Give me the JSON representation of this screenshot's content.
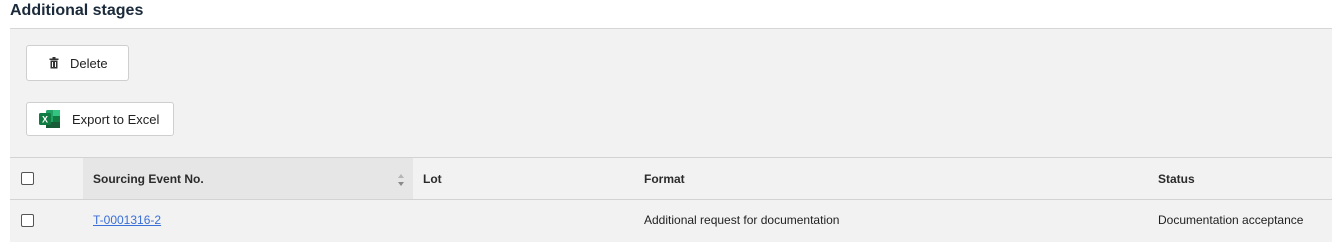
{
  "section": {
    "title": "Additional stages"
  },
  "toolbar": {
    "delete_label": "Delete",
    "export_label": "Export to Excel"
  },
  "table": {
    "columns": {
      "sourcing_event_no": "Sourcing Event No.",
      "lot": "Lot",
      "format": "Format",
      "status": "Status"
    },
    "rows": [
      {
        "sourcing_event_no": "T-0001316-2",
        "lot": "",
        "format": "Additional request for documentation",
        "status": "Documentation acceptance"
      }
    ]
  },
  "colors": {
    "panel_bg": "#f2f2f2",
    "link": "#3a6fd8",
    "excel_green": "#1d6f42"
  }
}
